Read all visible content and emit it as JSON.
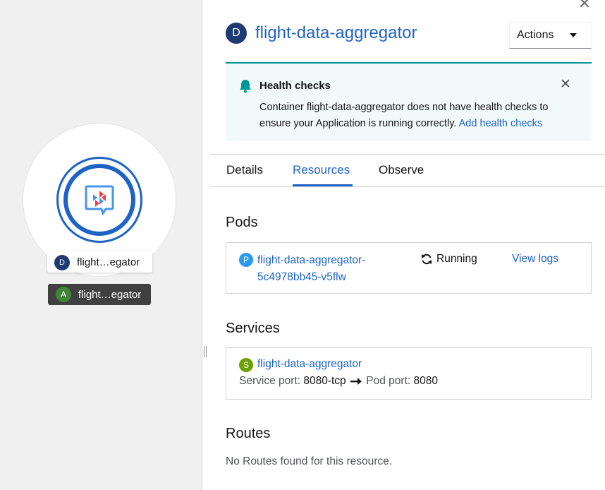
{
  "topology": {
    "node_label": "flight…egator",
    "node_badge": "D",
    "app_label": "flight…egator",
    "app_badge": "A"
  },
  "panel": {
    "close_icon": "✕",
    "title_badge": "D",
    "title": "flight-data-aggregator",
    "actions_label": "Actions",
    "alert": {
      "title": "Health checks",
      "body": "Container flight-data-aggregator does not have health checks to ensure your Application is running correctly.",
      "link": "Add health checks",
      "close_icon": "✕"
    },
    "tabs": [
      {
        "label": "Details"
      },
      {
        "label": "Resources"
      },
      {
        "label": "Observe"
      }
    ],
    "pods": {
      "title": "Pods",
      "badge": "P",
      "name": "flight-data-aggregator-5c4978bb45-v5flw",
      "status": "Running",
      "view_logs": "View logs"
    },
    "services": {
      "title": "Services",
      "badge": "S",
      "name": "flight-data-aggregator",
      "service_port_label": "Service port:",
      "service_port": "8080-tcp",
      "pod_port_label": "Pod port:",
      "pod_port": "8080"
    },
    "routes": {
      "title": "Routes",
      "empty": "No Routes found for this resource."
    }
  },
  "colors": {
    "accent": "#1e63c6",
    "deployment_badge": "#1e3a73",
    "application_badge": "#3e8635",
    "pod_badge": "#2b9af3",
    "service_badge": "#6ca100",
    "alert_border": "#009596"
  }
}
